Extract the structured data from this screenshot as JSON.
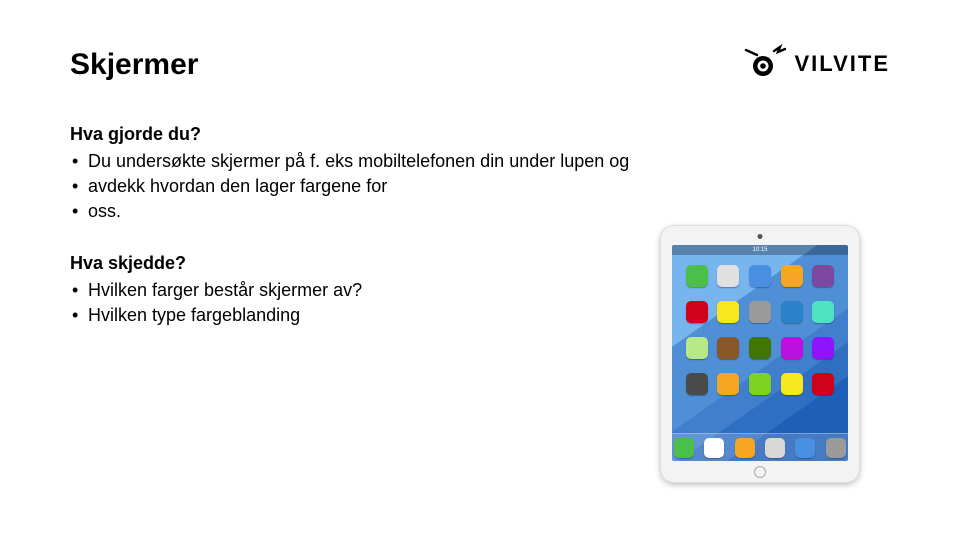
{
  "logo": {
    "text": "VILVITE"
  },
  "title": "Skjermer",
  "section1": {
    "heading": "Hva gjorde du?",
    "items": [
      "Du undersøkte skjermer på f. eks mobiltelefonen din under lupen og",
      "avdekk hvordan den lager fargene for",
      "oss."
    ]
  },
  "section2": {
    "heading": "Hva skjedde?",
    "items": [
      "Hvilken farger består skjermer av?",
      "Hvilken type fargeblanding"
    ]
  },
  "tablet": {
    "clock": "10:15",
    "icon_colors": [
      "#4abf4a",
      "#e0e0e0",
      "#4a90e2",
      "#f5a623",
      "#7b4aa0",
      "#d0021b",
      "#f8e71c",
      "#9b9b9b",
      "#2c82c9",
      "#50e3c2",
      "#b8e986",
      "#8b572a",
      "#417505",
      "#bd10e0",
      "#9013fe",
      "#4a4a4a",
      "#f5a623",
      "#7ed321",
      "#f8e71c",
      "#d0021b"
    ],
    "dock_colors": [
      "#4abf4a",
      "#ffffff",
      "#f5a623",
      "#d8d8d8",
      "#4a90e2",
      "#9b9b9b"
    ]
  }
}
